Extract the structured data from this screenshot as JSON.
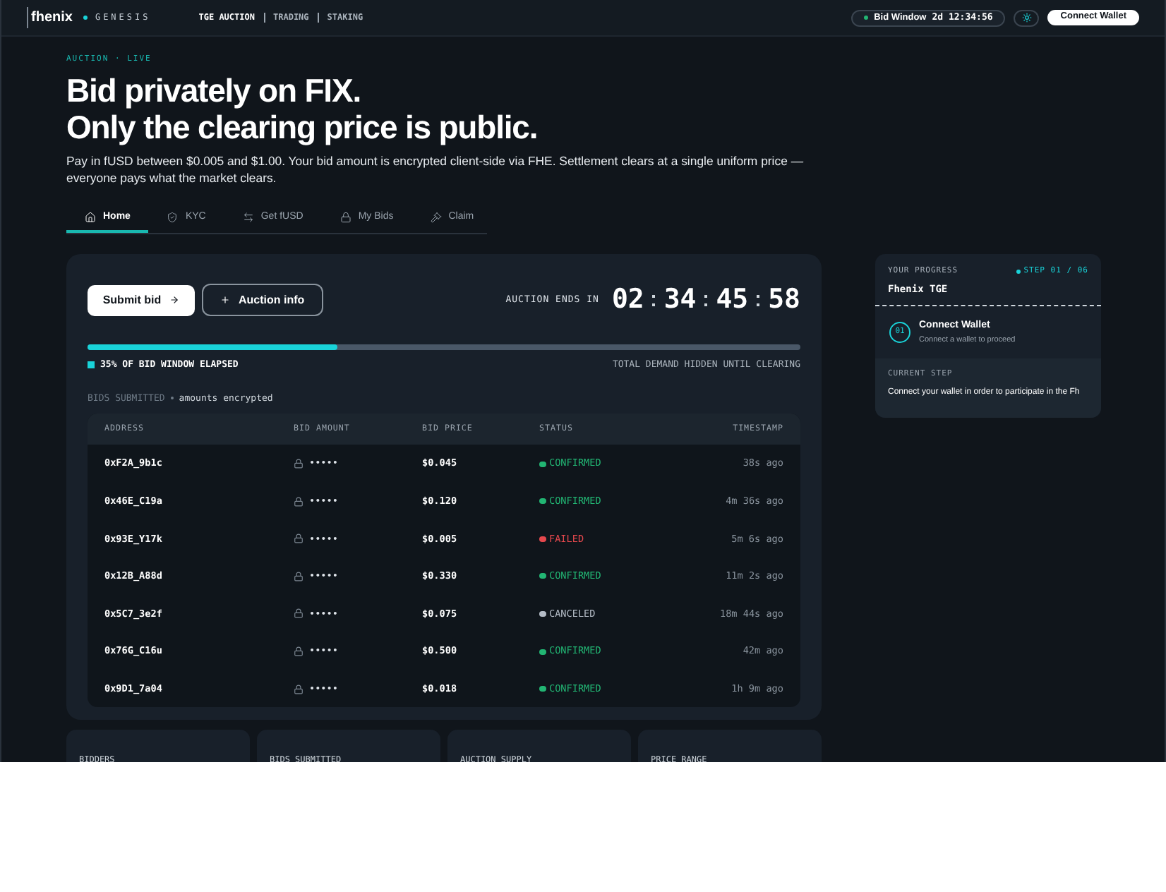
{
  "header": {
    "logo": "fhenix",
    "brand": "GENESIS",
    "nav": [
      {
        "label": "TGE AUCTION",
        "selected": true
      },
      {
        "label": "TRADING",
        "selected": false
      },
      {
        "label": "STAKING",
        "selected": false
      }
    ],
    "window_label": "Bid Window",
    "window_time": "2d 12:34:56",
    "connect_button": "Connect Wallet"
  },
  "hero": {
    "eyebrow": "AUCTION · LIVE",
    "title_lines": [
      "Bid privately on FIX.",
      "Only the clearing price is public."
    ],
    "description": "Pay in fUSD between $0.005 and $1.00. Your bid amount is encrypted client-side via FHE. Settlement clears at a single uniform price — everyone pays what the market clears."
  },
  "tabs": [
    {
      "label": "Home",
      "selected": true
    },
    {
      "label": "KYC",
      "selected": false
    },
    {
      "label": "Get fUSD",
      "selected": false
    },
    {
      "label": "My Bids",
      "selected": false
    },
    {
      "label": "Claim",
      "selected": false
    }
  ],
  "auction": {
    "submit_button": "Submit bid",
    "info_button": "Auction info",
    "ends_label": "AUCTION ENDS IN",
    "countdown": [
      "02",
      "34",
      "45",
      "58"
    ],
    "progress": {
      "level": 0.35,
      "label": "35% OF BID WINDOW ELAPSED",
      "note": "TOTAL DEMAND HIDDEN UNTIL CLEARING"
    },
    "bids_label": "BIDS SUBMITTED",
    "bids_note": "amounts encrypted"
  },
  "table": {
    "columns": [
      "ADDRESS",
      "BID AMOUNT",
      "BID PRICE",
      "STATUS",
      "TIMESTAMP"
    ],
    "rows": [
      {
        "address": "0xF2A_9b1c",
        "amount": "•••••",
        "price": "$0.045",
        "status": "CONFIRMED",
        "kind": "confirmed",
        "timestamp": "38s ago"
      },
      {
        "address": "0x46E_C19a",
        "amount": "•••••",
        "price": "$0.120",
        "status": "CONFIRMED",
        "kind": "confirmed",
        "timestamp": "4m 36s ago"
      },
      {
        "address": "0x93E_Y17k",
        "amount": "•••••",
        "price": "$0.005",
        "status": "FAILED",
        "kind": "failed",
        "timestamp": "5m 6s ago"
      },
      {
        "address": "0x12B_A88d",
        "amount": "•••••",
        "price": "$0.330",
        "status": "CONFIRMED",
        "kind": "confirmed",
        "timestamp": "11m 2s ago"
      },
      {
        "address": "0x5C7_3e2f",
        "amount": "•••••",
        "price": "$0.075",
        "status": "CANCELED",
        "kind": "canceled",
        "timestamp": "18m 44s ago"
      },
      {
        "address": "0x76G_C16u",
        "amount": "•••••",
        "price": "$0.500",
        "status": "CONFIRMED",
        "kind": "confirmed",
        "timestamp": "42m ago"
      },
      {
        "address": "0x9D1_7a04",
        "amount": "•••••",
        "price": "$0.018",
        "status": "CONFIRMED",
        "kind": "confirmed",
        "timestamp": "1h 9m ago"
      }
    ]
  },
  "progress_card": {
    "label": "YOUR PROGRESS",
    "title": "Fhenix TGE",
    "step": "STEP 01 / 06",
    "step_number": "01",
    "step_title": "Connect Wallet",
    "step_subtitle": "Connect a wallet to proceed",
    "current_label": "CURRENT STEP",
    "current_text": "Connect your wallet in order to participate in the Fh"
  },
  "stats": [
    "BIDDERS",
    "BIDS SUBMITTED",
    "AUCTION SUPPLY",
    "PRICE RANGE"
  ]
}
